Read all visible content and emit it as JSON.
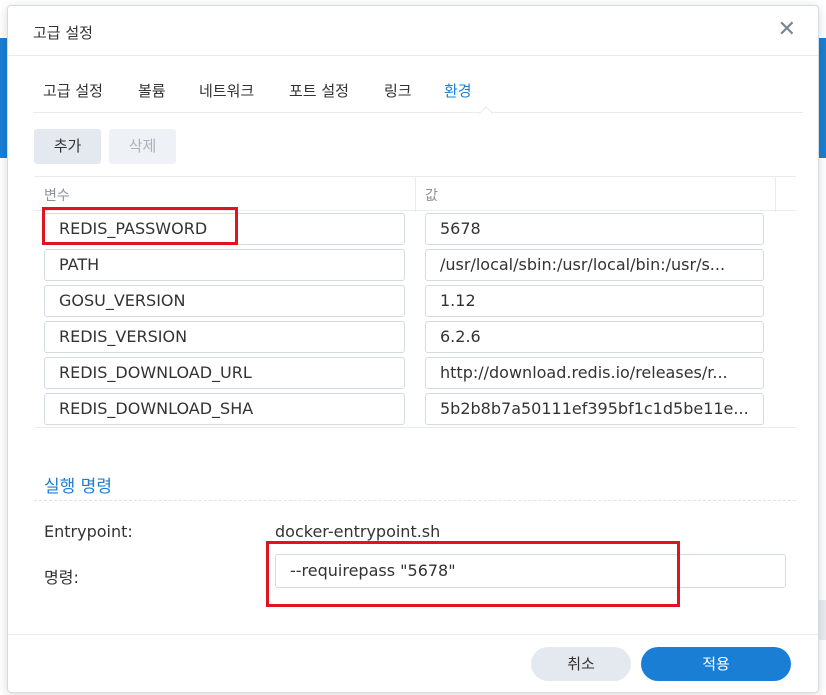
{
  "dialog": {
    "title": "고급 설정",
    "close_icon": "close-icon"
  },
  "tabs": [
    {
      "label": "고급 설정",
      "active": false
    },
    {
      "label": "볼륨",
      "active": false
    },
    {
      "label": "네트워크",
      "active": false
    },
    {
      "label": "포트 설정",
      "active": false
    },
    {
      "label": "링크",
      "active": false
    },
    {
      "label": "환경",
      "active": true
    }
  ],
  "toolbar": {
    "add_label": "추가",
    "delete_label": "삭제"
  },
  "env_table": {
    "columns": [
      "변수",
      "값"
    ],
    "rows": [
      {
        "name": "REDIS_PASSWORD",
        "value": "5678"
      },
      {
        "name": "PATH",
        "value": "/usr/local/sbin:/usr/local/bin:/usr/s..."
      },
      {
        "name": "GOSU_VERSION",
        "value": "1.12"
      },
      {
        "name": "REDIS_VERSION",
        "value": "6.2.6"
      },
      {
        "name": "REDIS_DOWNLOAD_URL",
        "value": "http://download.redis.io/releases/r..."
      },
      {
        "name": "REDIS_DOWNLOAD_SHA",
        "value": "5b2b8b7a50111ef395bf1c1d5be11e..."
      }
    ]
  },
  "execution": {
    "section_title": "실행 명령",
    "entrypoint_label": "Entrypoint:",
    "entrypoint_value": "docker-entrypoint.sh",
    "command_label": "명령:",
    "command_value": "--requirepass \"5678\""
  },
  "footer": {
    "cancel_label": "취소",
    "apply_label": "적용"
  },
  "colors": {
    "accent": "#1a7fd4",
    "highlight": "#e0141e"
  }
}
